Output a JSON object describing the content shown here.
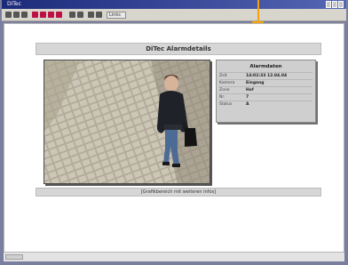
{
  "window": {
    "title": "DiTec"
  },
  "toolbar": {
    "icons": [
      "back-icon",
      "forward-icon",
      "stop-icon",
      "refresh-icon",
      "home-icon",
      "search-icon",
      "favorites-icon",
      "history-icon",
      "mail-icon",
      "print-icon"
    ],
    "address_label": "Links"
  },
  "page": {
    "heading": "DiTec Alarmdetails",
    "caption": "[Grafikbereich mit weiteren Infos]"
  },
  "info_card": {
    "title": "Alarmdaten",
    "rows": [
      {
        "key": "Zeit",
        "value": "14:02:33 12.04.04"
      },
      {
        "key": "Kamera",
        "value": "Eingang"
      },
      {
        "key": "Zone",
        "value": "Hof"
      },
      {
        "key": "Nr.",
        "value": "7"
      },
      {
        "key": "Status",
        "value": "A"
      }
    ]
  },
  "colors": {
    "titlebar": "#1c2a7a",
    "focus_marker": "#f2a40a"
  }
}
